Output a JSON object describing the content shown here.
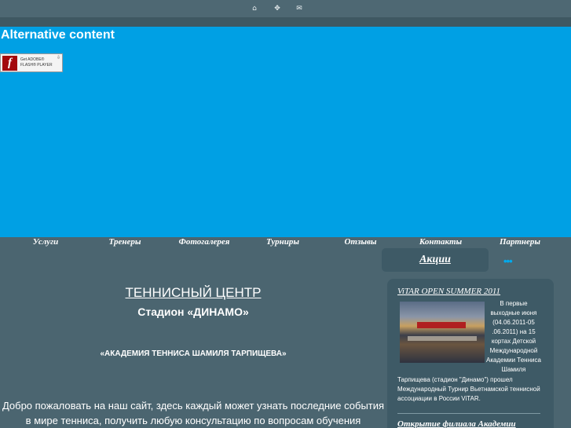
{
  "topbar": {
    "icons": [
      "home-icon",
      "sitemap-icon",
      "mail-icon"
    ]
  },
  "flash": {
    "alt_text": "Alternative content",
    "badge": {
      "line1": "Get ADOBE®",
      "line2": "FLASH® PLAYER",
      "logo": "f"
    }
  },
  "nav": {
    "items": [
      {
        "label": "Услуги"
      },
      {
        "label": "Тренеры"
      },
      {
        "label": "Фотогалерея"
      },
      {
        "label": "Турниры"
      },
      {
        "label": "Отзывы"
      },
      {
        "label": "Контакты"
      },
      {
        "label": "Партнеры"
      }
    ]
  },
  "main": {
    "title": "ТЕННИСНЫЙ ЦЕНТР",
    "stadium": "Стадион «ДИНАМО»",
    "academy": "«АКАДЕМИЯ ТЕННИСА ШАМИЛЯ ТАРПИЩЕВА»",
    "welcome": "Добро пожаловать на наш сайт, здесь каждый может узнать последние события в мире тенниса, получить любую консультацию по вопросам обучения"
  },
  "sidebar": {
    "tab_label": "Акции",
    "dots": "•••",
    "news": [
      {
        "title": "ViTAR OPEN SUMMER 2011",
        "side_text": "В первые выходные июня (04.06.2011-05 .06.2011) на 15 кортах Детской Международной Академии Тенниса Шамиля",
        "body": "Тарпищева (стадион \"Динамо\") прошел Международный Турнир Вьетнамской теннисной ассоциации в России ViTAR."
      },
      {
        "title": "Открытие филиала Академии"
      }
    ]
  },
  "colors": {
    "background": "#4b6570",
    "flash_area": "#00a0e4",
    "panel": "#3e5a66",
    "accent_dots": "#00aaee"
  }
}
